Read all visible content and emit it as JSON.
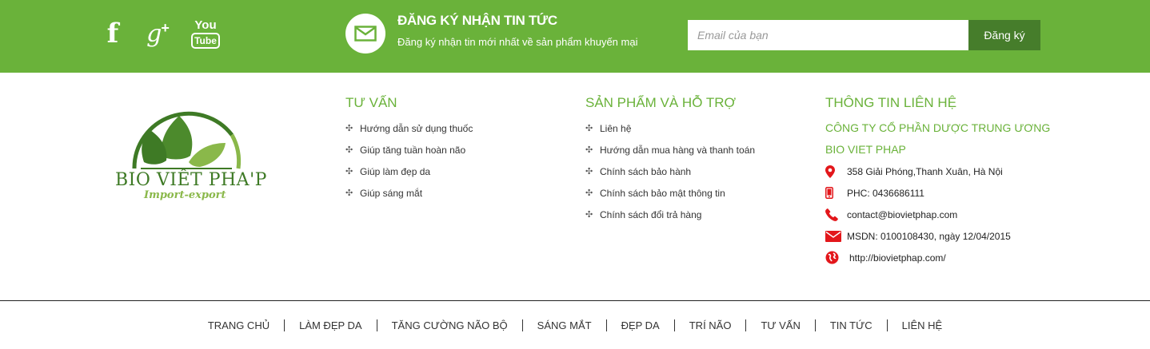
{
  "social": {
    "facebook_icon": "facebook-icon",
    "googleplus_icon": "google-plus-icon",
    "youtube_icon": "youtube-icon",
    "googleplus_glyph": "g",
    "googleplus_plus": "+",
    "youtube_top": "You",
    "youtube_bottom": "Tube"
  },
  "newsletter": {
    "title": "ĐĂNG KÝ NHẬN TIN TỨC",
    "description": "Đăng ký nhận tin mới nhất về sản phẩm khuyến mại",
    "email_placeholder": "Email của bạn",
    "email_value": "",
    "button_label": "Đăng ký"
  },
  "logo": {
    "name": "BIO VIÊT PHA'P",
    "tagline": "Import-export"
  },
  "columns": {
    "consult": {
      "title": "TƯ VẤN",
      "items": [
        "Hướng dẫn sử dụng thuốc",
        "Giúp tăng tuần hoàn não",
        "Giúp làm đẹp da",
        "Giúp sáng mắt"
      ]
    },
    "products": {
      "title": "SẢN PHẨM VÀ HỖ TRỢ",
      "items": [
        "Liên hệ",
        "Hướng dẫn mua hàng và thanh toán",
        "Chính sách bảo hành",
        "Chính sách bảo mật thông tin",
        "Chính sách đổi trả hàng"
      ]
    },
    "contact": {
      "title": "THÔNG TIN LIÊN HỆ",
      "company_line1": "CÔNG TY CỔ PHẦN DƯỢC TRUNG ƯƠNG",
      "company_line2": "BIO VIET PHAP",
      "address": "358 Giải Phóng,Thanh Xuân, Hà Nội",
      "phone": "PHC: 0436686111",
      "email": "contact@biovietphap.com",
      "license": "MSDN: 0100108430, ngày 12/04/2015",
      "website": "http://biovietphap.com/"
    }
  },
  "bottom_nav": [
    "TRANG CHỦ",
    "LÀM ĐẸP DA",
    "TĂNG CƯỜNG NÃO BỘ",
    "SÁNG MẮT",
    "ĐẸP DA",
    "TRÍ NÃO",
    "TƯ VẤN",
    "TIN TỨC",
    "LIÊN HỆ"
  ],
  "colors": {
    "brand_green": "#6ab23a",
    "button_dark_green": "#467d2b",
    "icon_red": "#e3171b"
  }
}
